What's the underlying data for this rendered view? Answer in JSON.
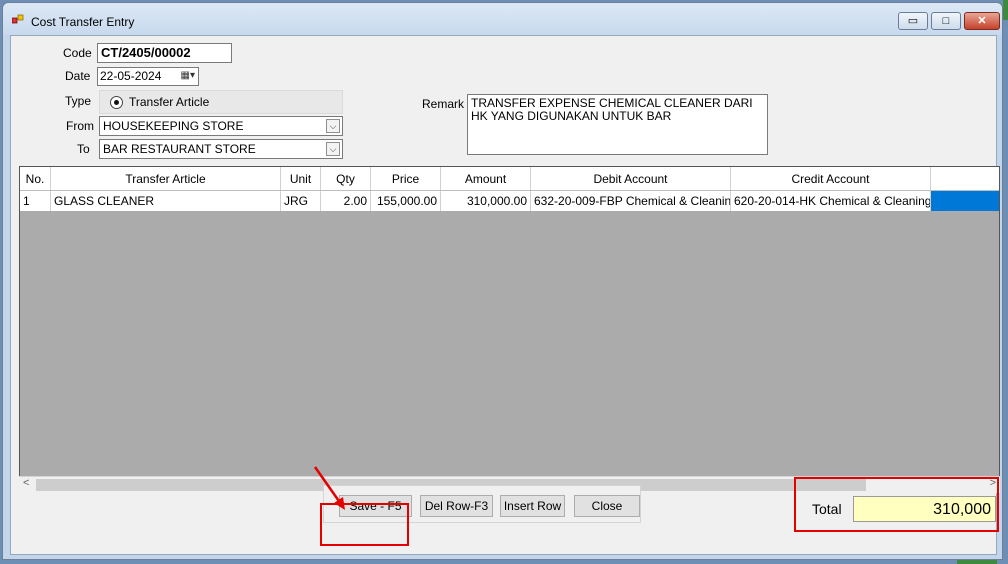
{
  "window": {
    "title": "Cost Transfer Entry",
    "min_glyph": "▭",
    "max_glyph": "□",
    "close_glyph": "✕"
  },
  "form": {
    "code_label": "Code",
    "code_value": "CT/2405/00002",
    "date_label": "Date",
    "date_value": "22-05-2024",
    "type_label": "Type",
    "type_option": "Transfer Article",
    "from_label": "From",
    "from_value": "HOUSEKEEPING STORE",
    "to_label": "To",
    "to_value": "BAR RESTAURANT STORE",
    "remark_label": "Remark",
    "remark_value": "TRANSFER EXPENSE CHEMICAL CLEANER DARI HK YANG DIGUNAKAN UNTUK BAR"
  },
  "grid": {
    "columns": [
      "No.",
      "Transfer Article",
      "Unit",
      "Qty",
      "Price",
      "Amount",
      "Debit Account",
      "Credit Account"
    ],
    "rows": [
      [
        "1",
        "GLASS CLEANER",
        "JRG",
        "2.00",
        "155,000.00",
        "310,000.00",
        "632-20-009-FBP Chemical & Cleaning ...",
        "620-20-014-HK Chemical & Cleaning S..."
      ]
    ]
  },
  "buttons": {
    "save": "Save - F5",
    "del_row": "Del Row-F3",
    "insert_row": "Insert Row",
    "close": "Close"
  },
  "total": {
    "label": "Total",
    "value": "310,000"
  },
  "colors": {
    "highlight": "#e50000",
    "selection": "#0078d7",
    "total_bg": "#ffffc0"
  }
}
